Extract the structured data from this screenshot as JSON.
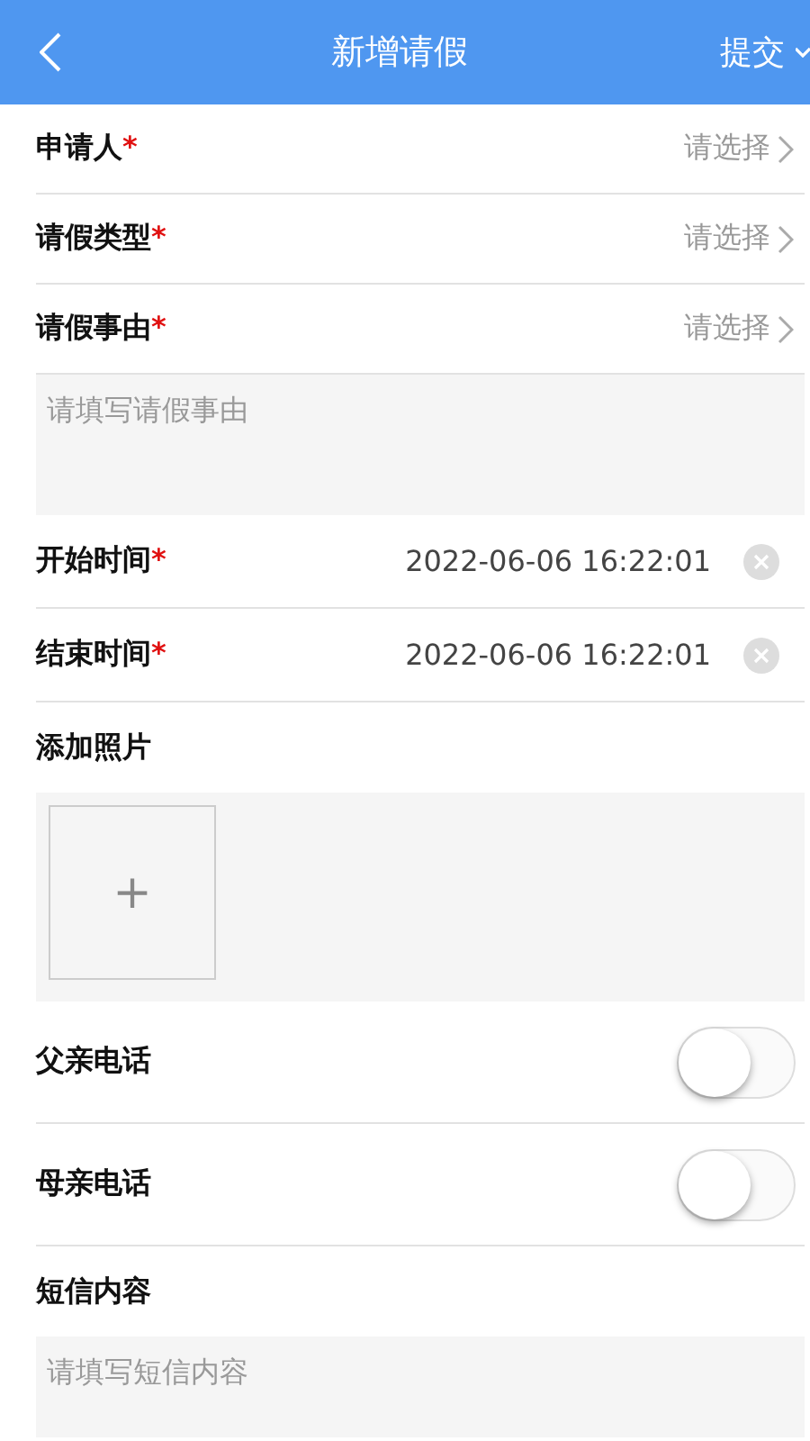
{
  "header": {
    "title": "新增请假",
    "action": "提交"
  },
  "fields": [
    {
      "kind": "select",
      "label": "申请人",
      "marker": "*",
      "placeholder": "请选择"
    },
    {
      "kind": "select",
      "label": "请假类型",
      "marker": "*",
      "placeholder": "请选择"
    },
    {
      "kind": "select",
      "label": "请假事由",
      "marker": "*",
      "placeholder": "请选择"
    },
    {
      "kind": "textarea",
      "placeholder": "请填写请假事由"
    },
    {
      "kind": "datetime",
      "label": "开始时间",
      "marker": "*",
      "value": "2022-06-06 16:22:01"
    },
    {
      "kind": "datetime",
      "label": "结束时间",
      "marker": "*",
      "value": "2022-06-06 16:22:01"
    },
    {
      "kind": "photos",
      "label": "添加照片",
      "add": "+"
    },
    {
      "kind": "toggle",
      "label": "父亲电话",
      "on": false
    },
    {
      "kind": "toggle",
      "label": "母亲电话",
      "on": false
    },
    {
      "kind": "heading",
      "label": "短信内容"
    },
    {
      "kind": "textarea",
      "placeholder": "请填写短信内容"
    }
  ]
}
